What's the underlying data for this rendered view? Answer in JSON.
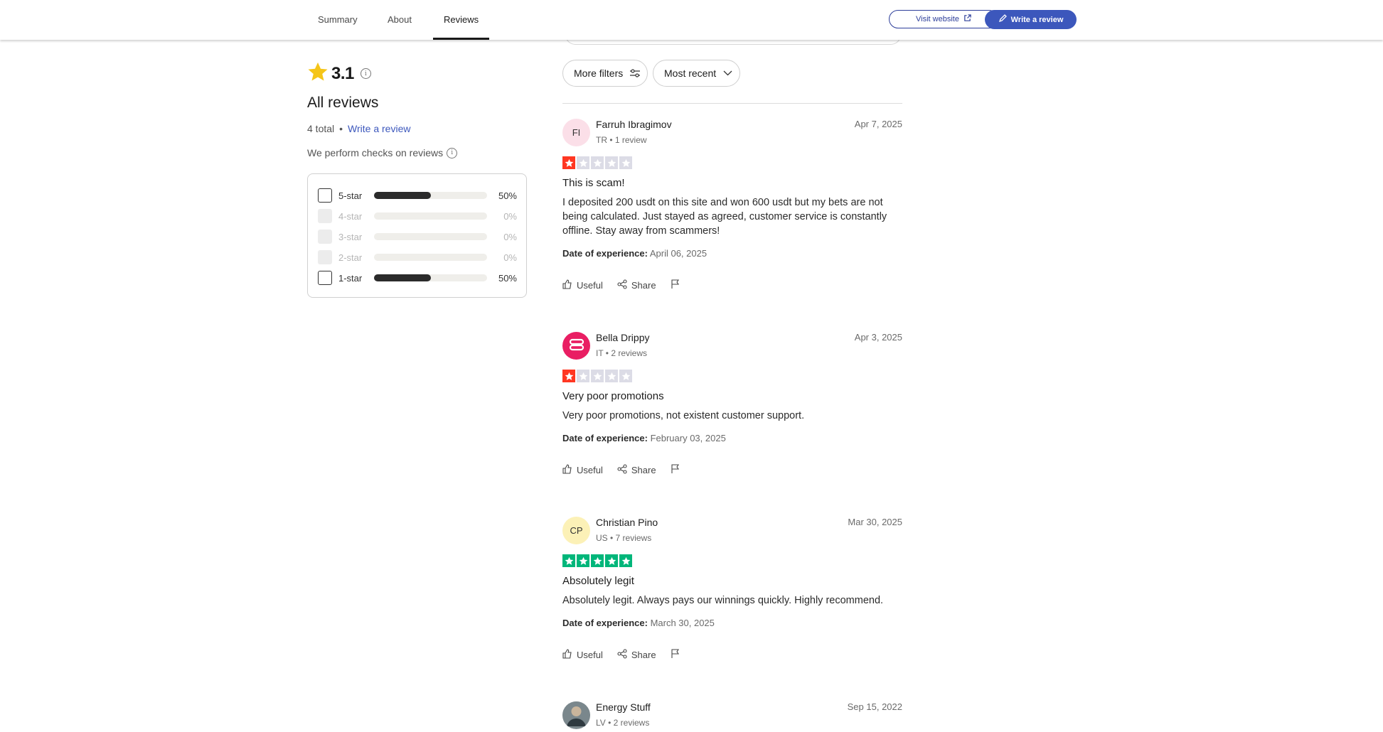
{
  "nav": {
    "tabs": [
      {
        "label": "Summary"
      },
      {
        "label": "About"
      },
      {
        "label": "Reviews"
      }
    ],
    "visit_label": "Visit website",
    "write_label": "Write a review"
  },
  "summary": {
    "rating": "3.1",
    "heading": "All reviews",
    "total": "4 total",
    "write_link": "Write a review",
    "checks_text": "We perform checks on reviews",
    "distribution": [
      {
        "label": "5-star",
        "pct": "50%",
        "fraction": 0.5,
        "enabled": true
      },
      {
        "label": "4-star",
        "pct": "0%",
        "fraction": 0,
        "enabled": false
      },
      {
        "label": "3-star",
        "pct": "0%",
        "fraction": 0,
        "enabled": false
      },
      {
        "label": "2-star",
        "pct": "0%",
        "fraction": 0,
        "enabled": false
      },
      {
        "label": "1-star",
        "pct": "50%",
        "fraction": 0.5,
        "enabled": true
      }
    ]
  },
  "filters": {
    "more_filters": "More filters",
    "sort": "Most recent"
  },
  "colors": {
    "accent": "#3c57bc",
    "one_star": "#ff3722",
    "five_star": "#00b67a",
    "star_empty": "#dcdce6",
    "rating_star": "#f5c518"
  },
  "reviews": [
    {
      "initials": "FI",
      "name": "Farruh Ibragimov",
      "meta": "TR • 1 review",
      "date": "Apr 7, 2025",
      "rating": 1,
      "title": "This is scam!",
      "body": "I deposited 200 usdt on this site and won 600 usdt but my bets are not being calculated. Just stayed as agreed, customer service is constantly offline. Stay away from scammers!",
      "exp_label": "Date of experience:",
      "exp_date": "April 06, 2025",
      "useful": "Useful",
      "share": "Share"
    },
    {
      "initials": "",
      "name": "Bella Drippy",
      "meta": "IT • 2 reviews",
      "date": "Apr 3, 2025",
      "rating": 1,
      "title": "Very poor promotions",
      "body": "Very poor promotions, not existent customer support.",
      "exp_label": "Date of experience:",
      "exp_date": "February 03, 2025",
      "useful": "Useful",
      "share": "Share"
    },
    {
      "initials": "CP",
      "name": "Christian Pino",
      "meta": "US • 7 reviews",
      "date": "Mar 30, 2025",
      "rating": 5,
      "title": "Absolutely legit",
      "body": "Absolutely legit. Always pays our winnings quickly. Highly recommend.",
      "exp_label": "Date of experience:",
      "exp_date": "March 30, 2025",
      "useful": "Useful",
      "share": "Share"
    },
    {
      "initials": "",
      "name": "Energy Stuff",
      "meta": "LV • 2 reviews",
      "date": "Sep 15, 2022"
    }
  ]
}
